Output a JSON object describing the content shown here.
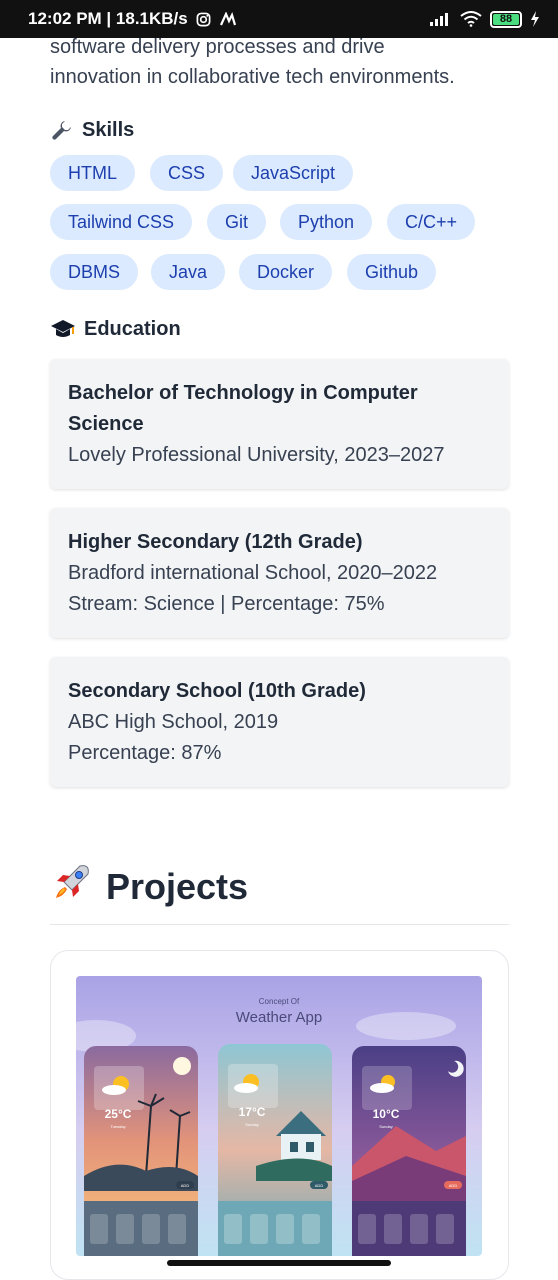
{
  "status_bar": {
    "time_speed": "12:02 PM | 18.1KB/s",
    "battery": "88"
  },
  "intro": {
    "text_line1": "software delivery processes and drive",
    "text_line2": "innovation in collaborative tech environments."
  },
  "skills": {
    "heading": "Skills",
    "items": [
      "HTML",
      "CSS",
      "JavaScript",
      "Tailwind CSS",
      "Git",
      "Python",
      "C/C++",
      "DBMS",
      "Java",
      "Docker",
      "Github"
    ]
  },
  "education": {
    "heading": "Education",
    "entries": [
      {
        "degree": "Bachelor of Technology in Computer Science",
        "institution": "Lovely Professional University, 2023–2027",
        "detail": ""
      },
      {
        "degree": "Higher Secondary (12th Grade)",
        "institution": "Bradford international School, 2020–2022",
        "detail": "Stream: Science | Percentage: 75%"
      },
      {
        "degree": "Secondary School (10th Grade)",
        "institution": "ABC High School, 2019",
        "detail": "Percentage: 87%"
      }
    ]
  },
  "projects": {
    "heading": "Projects",
    "items": [
      {
        "image_caption_small": "Concept Of",
        "image_caption_title": "Weather App",
        "phones": [
          {
            "temp": "25°C",
            "day": "Tuesday",
            "add_label": "ADD"
          },
          {
            "temp": "17°C",
            "day": "Sunday",
            "add_label": "ADD"
          },
          {
            "temp": "10°C",
            "day": "Sunday",
            "add_label": "ADD"
          }
        ]
      }
    ]
  },
  "colors": {
    "chip_bg": "#dbeafe",
    "chip_text": "#1e40af",
    "card_bg": "#f3f4f6",
    "status_bar_bg": "#111111"
  }
}
